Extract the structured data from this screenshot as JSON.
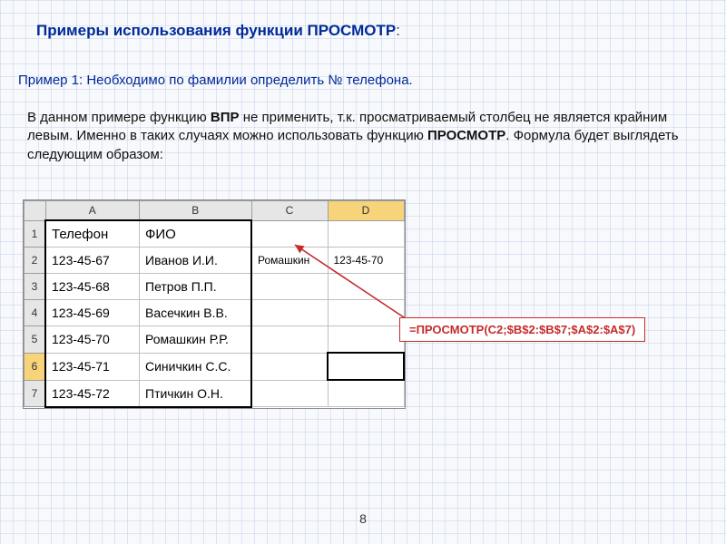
{
  "colors": {
    "accent": "#002a9a",
    "formula": "#c52b2b"
  },
  "heading": {
    "text": "Примеры использования функции ПРОСМОТР",
    "colon": ":"
  },
  "subheading": "Пример 1: Необходимо по фамилии определить № телефона.",
  "para": {
    "seg1": "В данном примере функцию ",
    "b1": "ВПР",
    "seg2": " не применить, т.к. просматриваемый столбец не является крайним левым. Именно в таких случаях можно использовать функцию ",
    "b2": "ПРОСМОТР",
    "seg3": ". Формула будет выглядеть следующим образом:"
  },
  "sheet": {
    "cols": [
      "A",
      "B",
      "C",
      "D"
    ],
    "rownums": [
      "1",
      "2",
      "3",
      "4",
      "5",
      "6",
      "7"
    ],
    "rows": [
      {
        "a": "Телефон",
        "b": "ФИО",
        "c": "",
        "d": ""
      },
      {
        "a": "123-45-67",
        "b": "Иванов И.И.",
        "c": "Ромашкин",
        "d": "123-45-70"
      },
      {
        "a": "123-45-68",
        "b": "Петров П.П.",
        "c": "",
        "d": ""
      },
      {
        "a": "123-45-69",
        "b": "Васечкин В.В.",
        "c": "",
        "d": ""
      },
      {
        "a": "123-45-70",
        "b": "Ромашкин Р.Р.",
        "c": "",
        "d": ""
      },
      {
        "a": "123-45-71",
        "b": "Синичкин С.С.",
        "c": "",
        "d": ""
      },
      {
        "a": "123-45-72",
        "b": "Птичкин О.Н.",
        "c": "",
        "d": ""
      }
    ],
    "selected_row": "6",
    "selected_col": "D"
  },
  "formula": "=ПРОСМОТР(C2;$B$2:$B$7;$A$2:$A$7)",
  "page_number": "8"
}
